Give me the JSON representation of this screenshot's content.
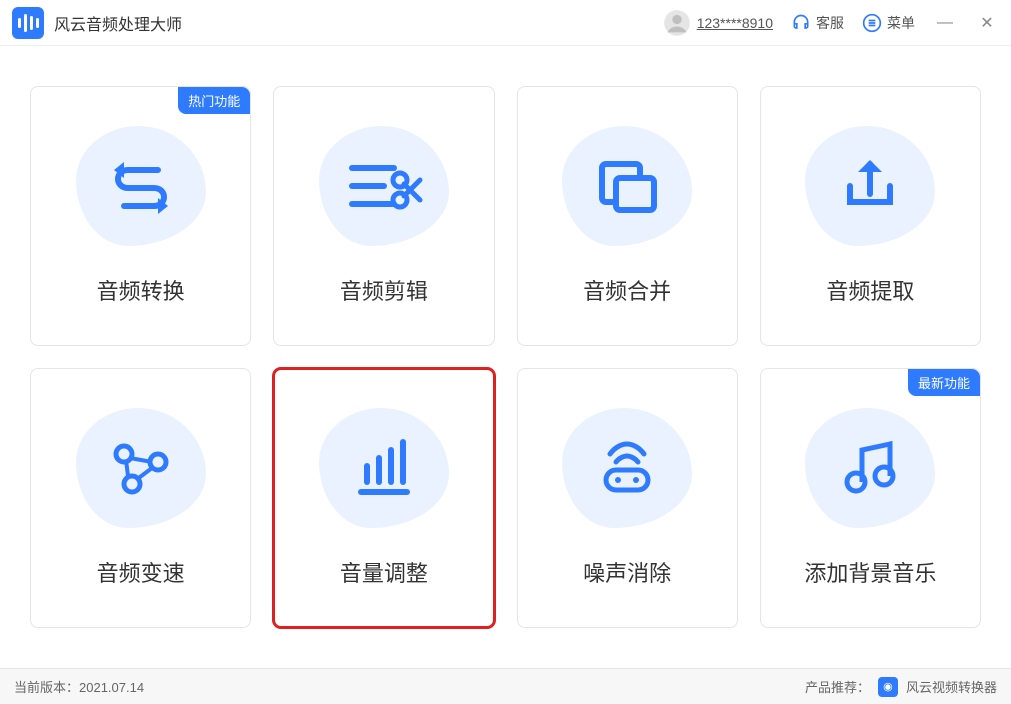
{
  "header": {
    "app_title": "风云音频处理大师",
    "user_id": "123****8910",
    "support_label": "客服",
    "menu_label": "菜单"
  },
  "cards": [
    {
      "label": "音频转换",
      "badge": "热门功能"
    },
    {
      "label": "音频剪辑",
      "badge": null
    },
    {
      "label": "音频合并",
      "badge": null
    },
    {
      "label": "音频提取",
      "badge": null
    },
    {
      "label": "音频变速",
      "badge": null
    },
    {
      "label": "音量调整",
      "badge": null,
      "highlighted": true
    },
    {
      "label": "噪声消除",
      "badge": null
    },
    {
      "label": "添加背景音乐",
      "badge": "最新功能"
    }
  ],
  "statusbar": {
    "version_prefix": "当前版本：",
    "version": "2021.07.14",
    "recommend_prefix": "产品推荐：",
    "recommend_product": "风云视频转换器"
  },
  "colors": {
    "primary": "#2f7bff"
  }
}
